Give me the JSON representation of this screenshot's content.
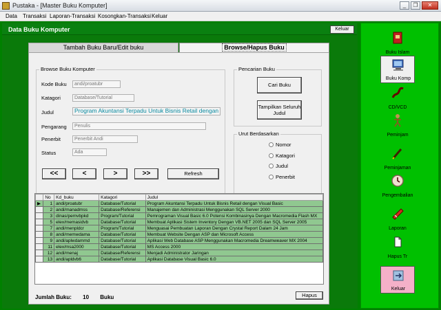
{
  "window": {
    "title": "Pustaka - [Master Buku Komputer]",
    "minimize": "_",
    "restore": "❐",
    "close": "✕"
  },
  "menu": [
    "Data",
    "Transaksi",
    "Laporan-Transaksi",
    "Kosongkan-Transaksi",
    "Keluar"
  ],
  "header": {
    "title": "Data Buku Komputer",
    "keluar_label": "Keluar"
  },
  "tabs": [
    "Tambah Buku Baru/Edit buku",
    "Browse/Hapus Buku"
  ],
  "browse": {
    "group_title": "Browse Buku Komputer",
    "fields": [
      {
        "label": "Kode Buku",
        "value": "andi/proatubr"
      },
      {
        "label": "Katagori",
        "value": "Database/Tutorial"
      },
      {
        "label": "Judul",
        "value": "Program Akuntansi Terpadu Untuk Bisnis Retail dengan Visual"
      },
      {
        "label": "Pengarang",
        "value": "Penulis"
      },
      {
        "label": "Penerbit",
        "value": "Penerbit Andi"
      },
      {
        "label": "Status",
        "value": "Ada"
      }
    ],
    "nav": {
      "first": "<<",
      "prev": "<",
      "next": ">",
      "last": ">>",
      "refresh": "Refresh"
    }
  },
  "pencarian": {
    "title": "Pencarian Buku",
    "cari_label": "Cari Buku",
    "tampilkan_label": "Tampilkan Seluruh Judul"
  },
  "urut": {
    "title": "Urut Berdasarkan",
    "options": [
      "Nomor",
      "Katagori",
      "Judul",
      "Penerbit"
    ]
  },
  "table": {
    "columns": [
      "No",
      "Kd_buku",
      "Katagori",
      "Judul"
    ],
    "rows": [
      [
        "1",
        "andi/proatubr",
        "Database/Tutorial",
        "Program Akuntansi Terpadu Untuk Bisnis Retail dengan Visual Basic"
      ],
      [
        "2",
        "andi/manadmss",
        "Database/Referensi",
        "Manajemen dan Administrasi Menggunakan SQL Server 2000"
      ],
      [
        "3",
        "dinas/pemvbpkd",
        "Program/Tutorial",
        "Pemrograman Visual Basic 6.0 Potensi Kombinasinya Dengan Macromedia Flash MX"
      ],
      [
        "5",
        "elex/memasidvb",
        "Database/Tutorial",
        "Membuat Aplikasi Sistem Inventory Dengan VB.NET 2005  dan SQL Server 2005"
      ],
      [
        "7",
        "andi/menpldcr",
        "Program/Tutorial",
        "Menguasai Pembuatan Laporan Dengan Crystal Report Dalam 24 Jam"
      ],
      [
        "8",
        "andi/memwdama",
        "Database/Tutorial",
        "Membuat Website Dengan ASP dan Microsoft Access"
      ],
      [
        "9",
        "andi/aplwdammd",
        "Database/Tutorial",
        "Aplikasi Web Database ASP Menggunakan Macromedia Dreamweaver MX 2004"
      ],
      [
        "11",
        "elex/msa2000",
        "Database/Tutorial",
        "MS Access 2000"
      ],
      [
        "12",
        "andi/menaj",
        "Database/Referensi",
        "Menjadi Administrator Jaringan"
      ],
      [
        "13",
        "andi/apldvb6",
        "Database/Tutorial",
        "Aplikasi Database Visual Basic 6.0"
      ]
    ]
  },
  "footer": {
    "jumlah_label": "Jumlah Buku:",
    "jumlah_value": "10",
    "jumlah_unit": "Buku",
    "hapus_label": "Hapus"
  },
  "sidebar": [
    {
      "label": "Buku Islam",
      "icon": "book-icon"
    },
    {
      "label": "Buku Komp",
      "icon": "computer-icon"
    },
    {
      "label": "CD/VCD",
      "icon": "cd-icon"
    },
    {
      "label": "Peminjam",
      "icon": "person-icon"
    },
    {
      "label": "Peminjaman",
      "icon": "pen-icon"
    },
    {
      "label": "Pengembalian",
      "icon": "clock-icon"
    },
    {
      "label": "Laporan",
      "icon": "report-icon"
    },
    {
      "label": "Hapus Tr",
      "icon": "document-icon"
    },
    {
      "label": "Keluar",
      "icon": "exit-icon"
    }
  ]
}
